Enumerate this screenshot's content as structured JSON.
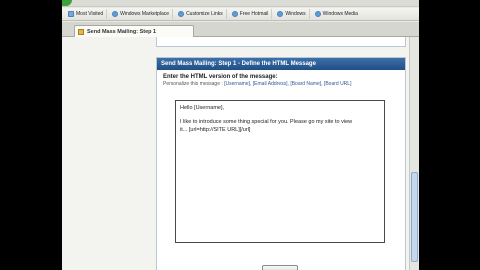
{
  "favorites": [
    {
      "label": "Most Visited",
      "icon": "folder-icon"
    },
    {
      "label": "Windows Marketplace",
      "icon": "ie-icon"
    },
    {
      "label": "Customize Links",
      "icon": "ie-icon"
    },
    {
      "label": "Free Hotmail",
      "icon": "ie-icon"
    },
    {
      "label": "Windows",
      "icon": "ie-icon"
    },
    {
      "label": "Windows Media",
      "icon": "ie-icon"
    }
  ],
  "tab": {
    "title": "Send Mass Mailing: Step 1"
  },
  "panel": {
    "header": "Send Mass Mailing: Step 1 - Define the HTML Message",
    "prompt": "Enter the HTML version of the message:",
    "personalize_prefix": "Personalize this message :",
    "tokens": [
      "[Username]",
      "[Email Address]",
      "[Board Name]",
      "[Board URL]"
    ]
  },
  "editor": {
    "line1": "Hello [Username],",
    "line2": "I like to introduce some thing special for you. Please go my site to view",
    "line3": "it... [url=http://SITE URL][/url]"
  },
  "colors": {
    "header_blue": "#2a5a94",
    "link_blue": "#2a5a9a"
  }
}
